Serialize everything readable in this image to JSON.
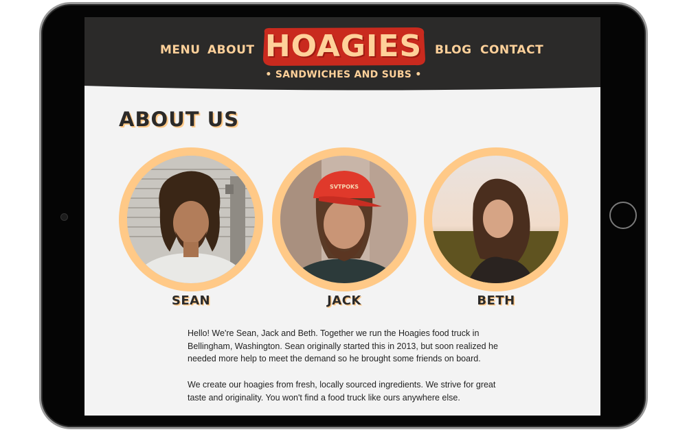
{
  "nav": {
    "left": [
      {
        "label": "MENU"
      },
      {
        "label": "ABOUT"
      }
    ],
    "right": [
      {
        "label": "BLOG"
      },
      {
        "label": "CONTACT"
      }
    ]
  },
  "brand": {
    "logo": "HOAGIES",
    "tagline": "• SANDWICHES AND SUBS •"
  },
  "page": {
    "title": "ABOUT US"
  },
  "team": [
    {
      "name": "SEAN"
    },
    {
      "name": "JACK"
    },
    {
      "name": "BETH"
    }
  ],
  "about": {
    "paragraphs": [
      "Hello! We're Sean, Jack and Beth. Together we run the Hoagies food truck in Bellingham, Washington. Sean originally started this in 2013, but soon realized he needed more help to meet the demand so he brought some friends on board.",
      "We create our hoagies from fresh, locally sourced ingredients. We strive for great taste and originality. You won't find a food truck like ours anywhere else."
    ]
  },
  "colors": {
    "header_bg": "#2b2a29",
    "accent": "#ffd19a",
    "ring": "#ffc987",
    "logo_badge": "#c92a1e",
    "page_bg": "#f3f3f3"
  }
}
